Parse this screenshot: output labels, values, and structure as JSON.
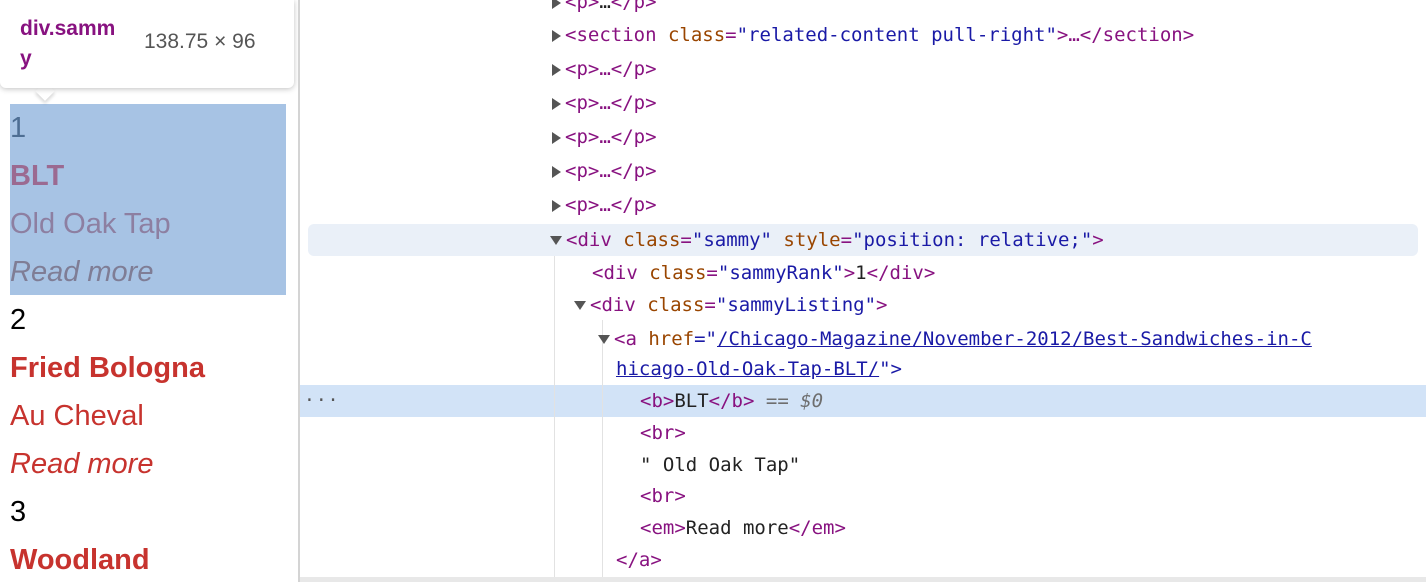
{
  "tooltip": {
    "element_name": "div.sammy",
    "dimensions": "138.75 × 96"
  },
  "entries": [
    {
      "rank": "1",
      "title": "BLT",
      "venue": "Old Oak Tap",
      "read_more": "Read more"
    },
    {
      "rank": "2",
      "title": "Fried Bologna",
      "venue": "Au Cheval",
      "read_more": "Read more"
    },
    {
      "rank": "3",
      "title": "Woodland",
      "venue": "",
      "read_more": ""
    }
  ],
  "dom": {
    "line0": {
      "open": "<p>",
      "ell": "…",
      "close": "</p>"
    },
    "section": {
      "tag_open": "<section",
      "attr": "class",
      "eq": "=",
      "value": "\"related-content pull-right\"",
      "end": ">…</section>"
    },
    "p_collapsed": {
      "text": "<p>…</p>"
    },
    "div_sammy": {
      "tag_open": "<div",
      "attr1": "class",
      "val1": "\"sammy\"",
      "attr2": "style",
      "val2": "\"position: relative;\"",
      "end": ">"
    },
    "sammy_rank": {
      "tag_open": "<div",
      "attr": "class",
      "val": "\"sammyRank\"",
      "gt": ">",
      "text": "1",
      "close": "</div>"
    },
    "sammy_listing": {
      "tag_open": "<div",
      "attr": "class",
      "val": "\"sammyListing\"",
      "end": ">"
    },
    "anchor": {
      "tag_open": "<a",
      "attr": "href",
      "eq": "=\"",
      "href_part1": "/Chicago-Magazine/November-2012/Best-Sandwiches-in-C",
      "href_part2": "hicago-Old-Oak-Tap-BLT/",
      "end": "\">"
    },
    "b_line": {
      "open": "<b>",
      "text": "BLT",
      "close": "</b>",
      "ref": "== $0"
    },
    "br": "<br>",
    "text_node": "\" Old Oak Tap\"",
    "em_line": {
      "open": "<em>",
      "text": "Read more",
      "close": "</em>"
    },
    "a_close": "</a>",
    "dots": "···"
  }
}
